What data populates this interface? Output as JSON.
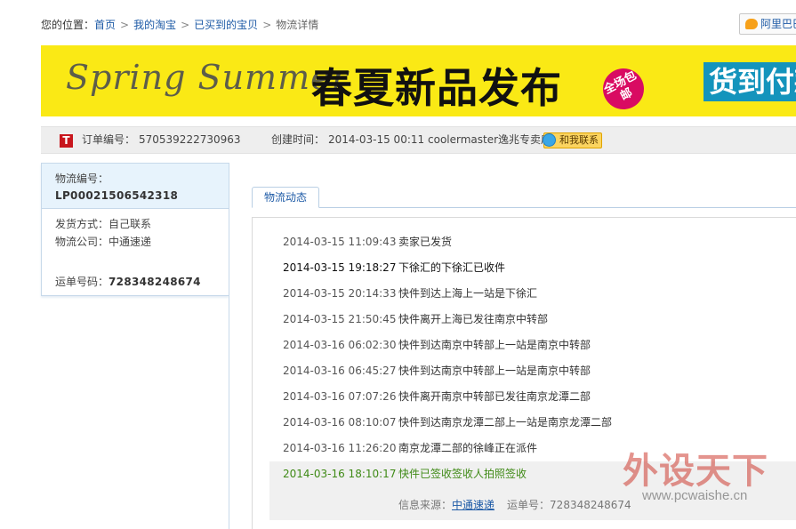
{
  "breadcrumb": {
    "prefix": "您的位置：",
    "items": [
      "首页",
      "我的淘宝",
      "已买到的宝贝"
    ],
    "separator": ">",
    "current": "物流详情"
  },
  "aliww": {
    "label": "阿里巴巴"
  },
  "banner": {
    "script_text": "Spring Summer",
    "headline": "春夏新品发布",
    "badge": "全场包邮",
    "cod": "货到付款"
  },
  "order": {
    "order_no_label": "订单编号：",
    "order_no": "570539222730963",
    "created_label": "创建时间：",
    "created_time": "2014-03-15 00:11",
    "shop_name": "coolermaster逸兆专卖店",
    "contact_label": "和我联系"
  },
  "logistics": {
    "no_label": "物流编号：",
    "no": "LP00021506542318",
    "ship_method_label": "发货方式：",
    "ship_method": "自己联系",
    "company_label": "物流公司：",
    "company": "中通速递",
    "waybill_label": "运单号码：",
    "waybill": "728348248674"
  },
  "tab": {
    "label": "物流动态"
  },
  "timeline": [
    {
      "time": "2014-03-15 11:09:43",
      "event": "卖家已发货"
    },
    {
      "time": "2014-03-15 19:18:27",
      "event": "下徐汇的下徐汇已收件"
    },
    {
      "time": "2014-03-15 20:14:33",
      "event": "快件到达上海上一站是下徐汇"
    },
    {
      "time": "2014-03-15 21:50:45",
      "event": "快件离开上海已发往南京中转部"
    },
    {
      "time": "2014-03-16 06:02:30",
      "event": "快件到达南京中转部上一站是南京中转部"
    },
    {
      "time": "2014-03-16 06:45:27",
      "event": "快件到达南京中转部上一站是南京中转部"
    },
    {
      "time": "2014-03-16 07:07:26",
      "event": "快件离开南京中转部已发往南京龙潭二部"
    },
    {
      "time": "2014-03-16 08:10:07",
      "event": "快件到达南京龙潭二部上一站是南京龙潭二部"
    },
    {
      "time": "2014-03-16 11:26:20",
      "event": "南京龙潭二部的徐峰正在派件"
    },
    {
      "time": "2014-03-16 18:10:17",
      "event": "快件已签收签收人拍照签收"
    }
  ],
  "source": {
    "label": "信息来源：",
    "company": "中通速递",
    "waybill_label": "运单号：",
    "waybill": "728348248674"
  },
  "watermark": {
    "cn": "外设天下",
    "url": "www.pcwaishe.cn"
  },
  "colors": {
    "link": "#1d5aa6",
    "banner_bg": "#fae915",
    "latest_green": "#3f8a16",
    "panel_blue": "#e7f3fc"
  }
}
